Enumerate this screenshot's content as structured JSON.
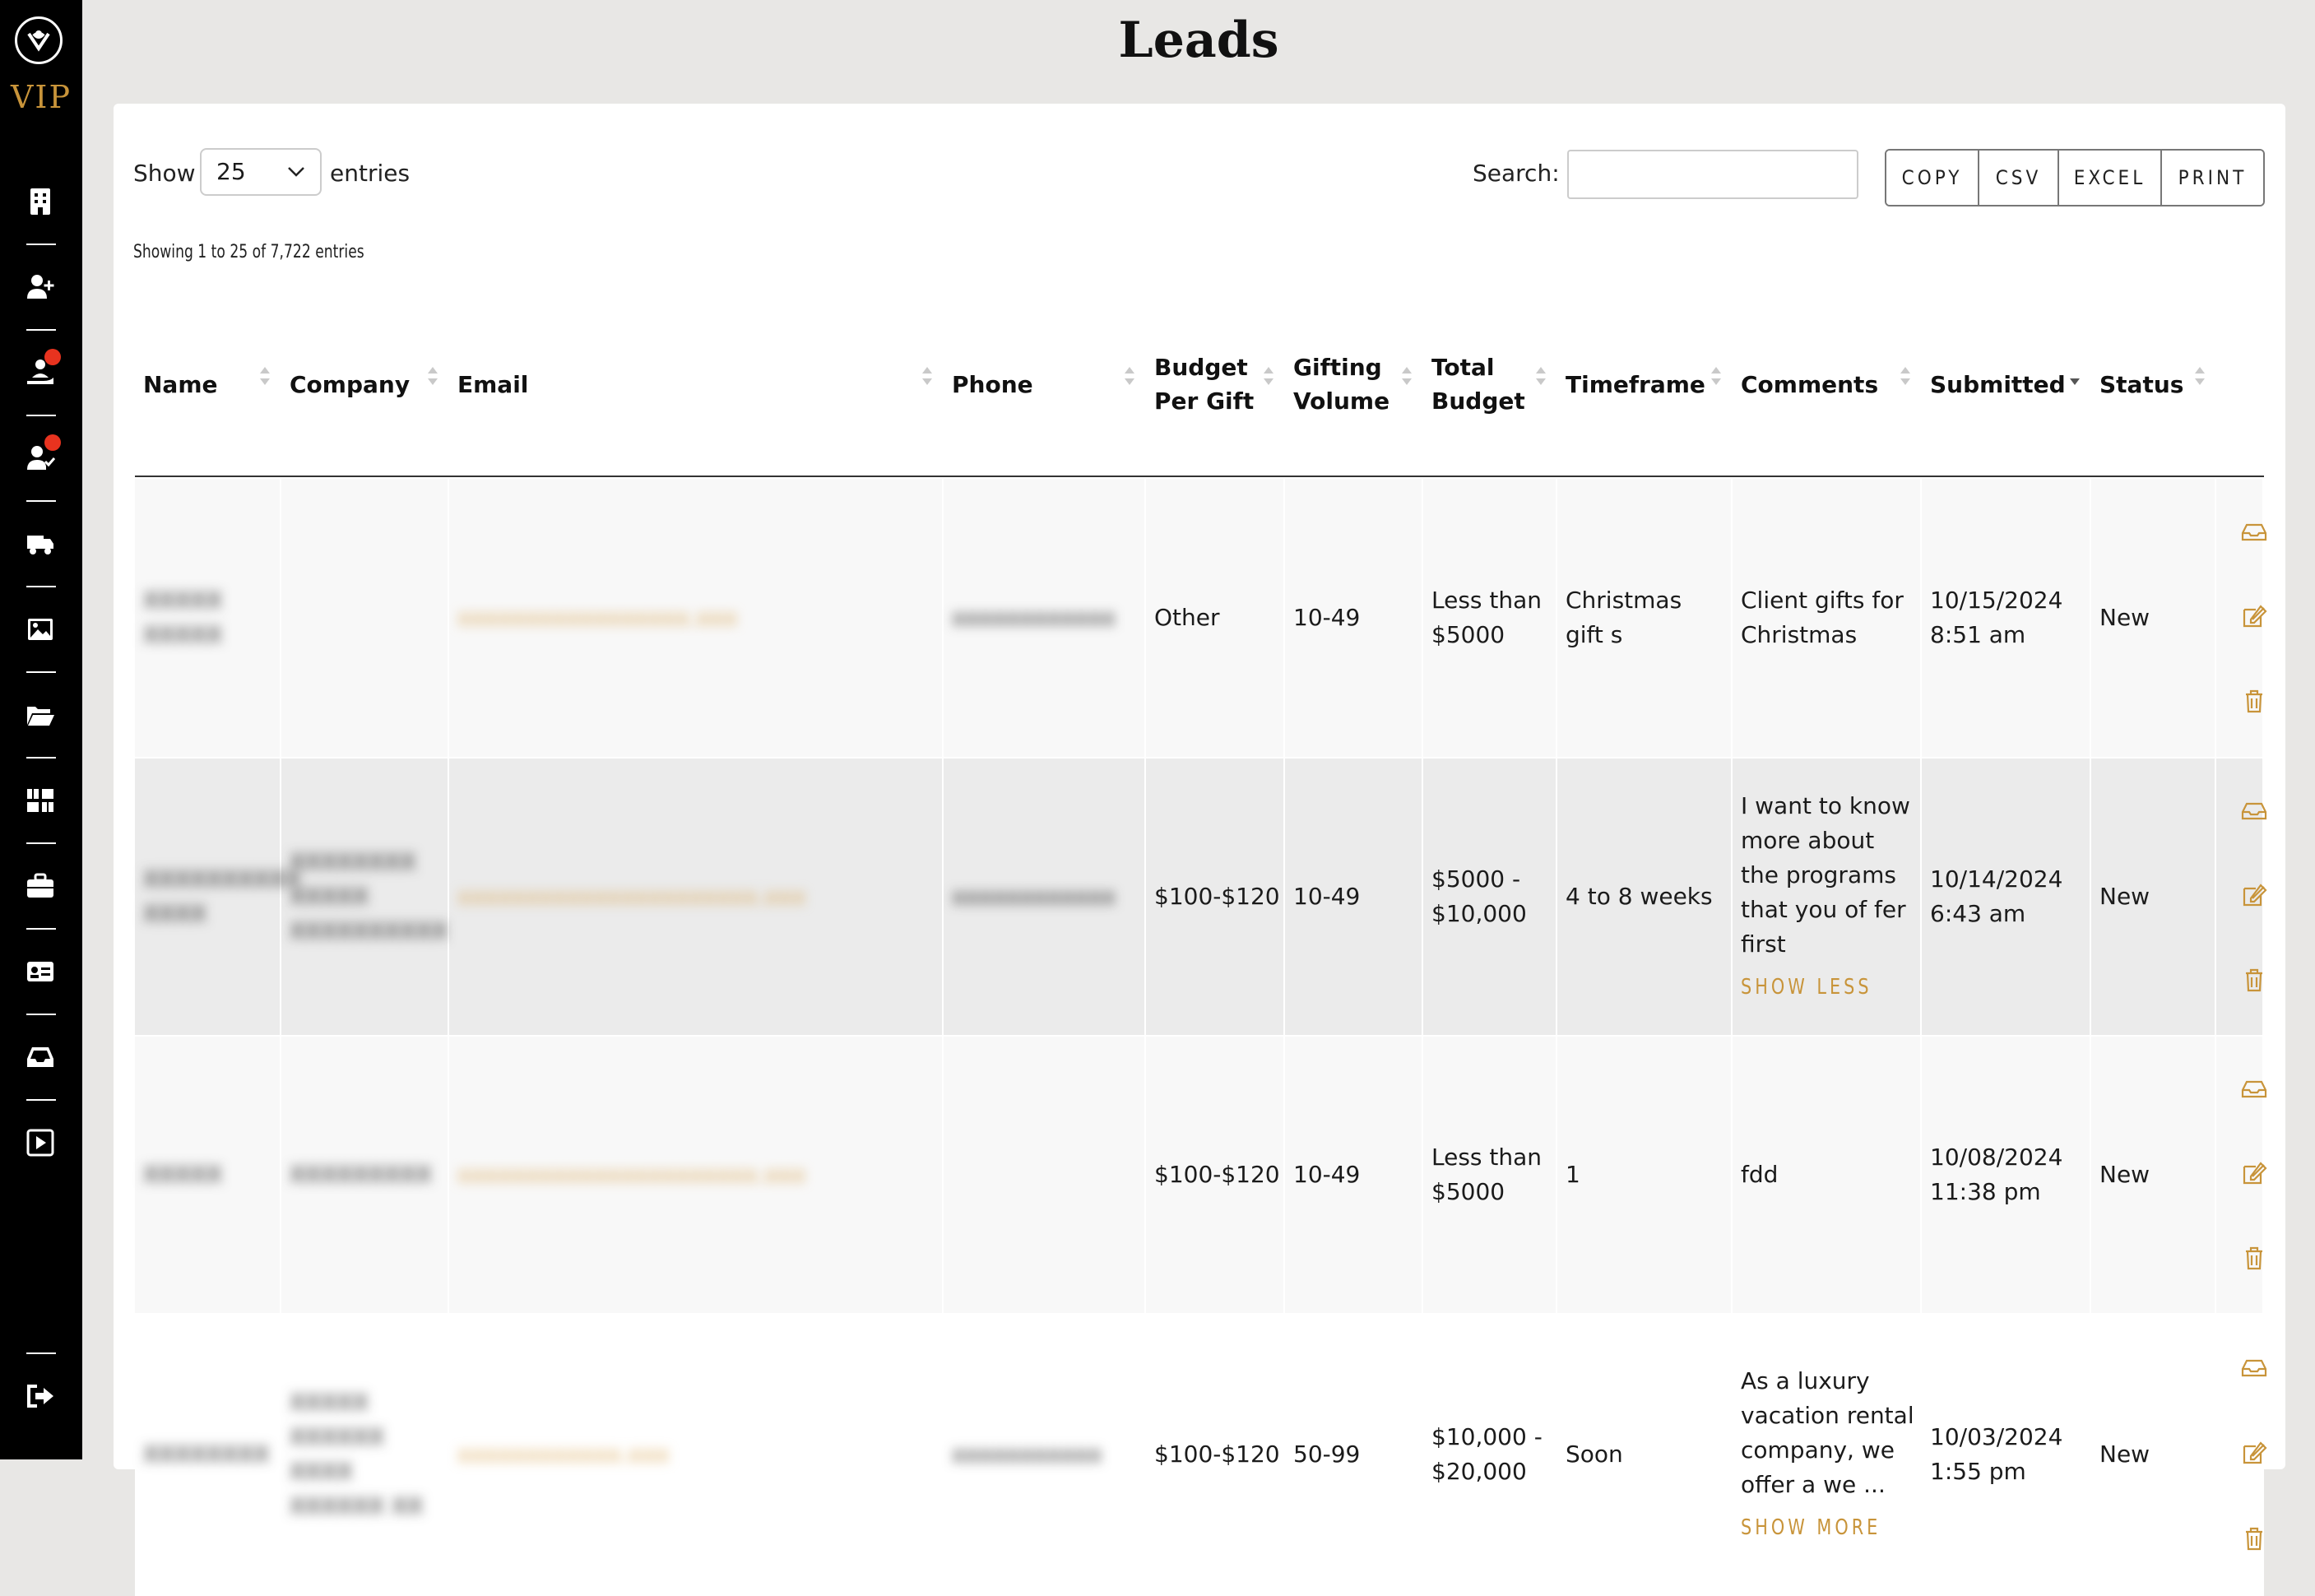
{
  "brand": {
    "logo_text": "VIP"
  },
  "page": {
    "title": "Leads"
  },
  "sidebar": {
    "items": [
      {
        "icon": "building-icon"
      },
      {
        "icon": "add-user-icon"
      },
      {
        "icon": "hand-user-icon",
        "badge": true
      },
      {
        "icon": "user-check-icon",
        "badge": true
      },
      {
        "icon": "truck-icon"
      },
      {
        "icon": "image-icon"
      },
      {
        "icon": "folder-open-icon"
      },
      {
        "icon": "gifts-icon"
      },
      {
        "icon": "briefcase-icon"
      },
      {
        "icon": "id-card-icon"
      },
      {
        "icon": "inbox-icon"
      },
      {
        "icon": "play-square-icon"
      },
      {
        "icon": "logout-icon"
      }
    ]
  },
  "controls": {
    "show_label": "Show",
    "page_length": "25",
    "entries_label": "entries",
    "search_label": "Search:",
    "search_value": "",
    "buttons": {
      "copy": "COPY",
      "csv": "CSV",
      "excel": "EXCEL",
      "print": "PRINT"
    },
    "info": "Showing 1 to 25 of 7,722 entries"
  },
  "table": {
    "headers": {
      "name": "Name",
      "company": "Company",
      "email": "Email",
      "phone": "Phone",
      "budget_per_gift": "Budget Per Gift",
      "gifting_volume": "Gifting Volume",
      "total_budget": "Total Budget",
      "timeframe": "Timeframe",
      "comments": "Comments",
      "submitted": "Submitted",
      "status": "Status"
    },
    "sorted_column": "submitted",
    "rows": [
      {
        "name": "XXXXX XXXXX",
        "company": "",
        "email": "xxxxxxxxxxxxxxxxx.xxx",
        "phone": "xxxxxxxxxxxx",
        "budget_per_gift": "Other",
        "gifting_volume": "10-49",
        "total_budget": "Less than $5000",
        "timeframe": "Christmas gift s",
        "comments": "Client gifts for Christmas",
        "comment_link": "",
        "submitted": "10/15/2024 8:51 am",
        "status": "New"
      },
      {
        "name": "XXXXXXXXXX XXXX",
        "company": "XXXXXXXX XXXXX XXXXXXXXXX",
        "email": "xxxxxxxxxxxxxxxxxxxxxx.xxx",
        "phone": "xxxxxxxxxxxx",
        "budget_per_gift": "$100-$120",
        "gifting_volume": "10-49",
        "total_budget": "$5000 - $10,000",
        "timeframe": "4 to 8 weeks",
        "comments": "I want to know more about the programs that you of fer first",
        "comment_link": "SHOW LESS",
        "submitted": "10/14/2024 6:43 am",
        "status": "New"
      },
      {
        "name": "XXXXX",
        "company": "XXXXXXXXX",
        "email": "xxxxxxxxxxxxxxxxxxxxxx.xxx",
        "phone": "",
        "budget_per_gift": "$100-$120",
        "gifting_volume": "10-49",
        "total_budget": "Less than $5000",
        "timeframe": "1",
        "comments": "fdd",
        "comment_link": "",
        "submitted": "10/08/2024 11:38 pm",
        "status": "New"
      },
      {
        "name": "XXXXXXXX",
        "company": "XXXXX XXXXXX XXXX XXXXXX XX",
        "email": "xxxxxxxxxxxx.xxx",
        "phone": "xxxxxxxxxxx",
        "budget_per_gift": "$100-$120",
        "gifting_volume": "50-99",
        "total_budget": "$10,000 - $20,000",
        "timeframe": "Soon",
        "comments": "As a luxury vacation rental company, we offer a we ...",
        "comment_link": "SHOW MORE",
        "submitted": "10/03/2024 1:55 pm",
        "status": "New"
      }
    ]
  }
}
